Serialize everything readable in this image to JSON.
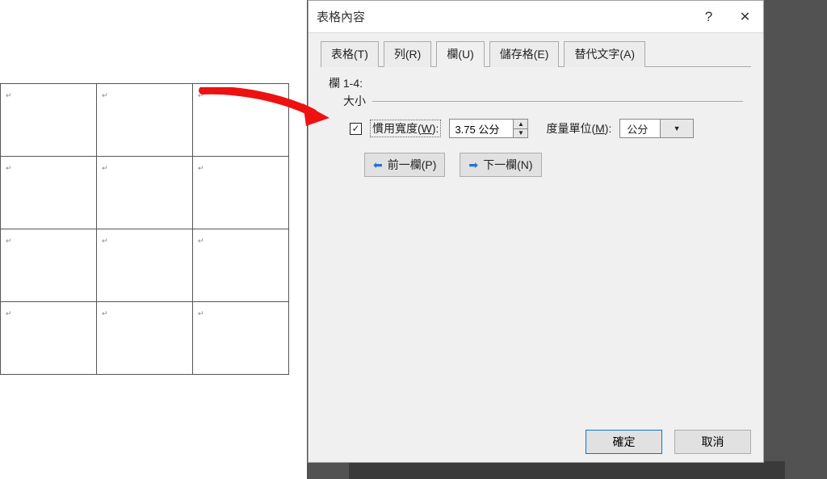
{
  "dialog": {
    "title": "表格內容",
    "help_icon": "?",
    "close_icon": "✕"
  },
  "tabs": {
    "table": "表格(T)",
    "row": "列(R)",
    "column": "欄(U)",
    "cell": "儲存格(E)",
    "alt": "替代文字(A)",
    "active": "column"
  },
  "column_panel": {
    "range_label": "欄 1-4:",
    "size_label": "大小",
    "pref_width": {
      "checked": true,
      "label_pre": "慣用寬度(",
      "label_hot": "W",
      "label_post": "):",
      "value": "3.75 公分"
    },
    "units": {
      "label_pre": "度量單位(",
      "label_hot": "M",
      "label_post": "):",
      "value": "公分"
    },
    "prev_label": "前一欄(P)",
    "next_label": "下一欄(N)"
  },
  "footer": {
    "ok": "確定",
    "cancel": "取消"
  },
  "doc": {
    "cell_mark": "↵"
  }
}
